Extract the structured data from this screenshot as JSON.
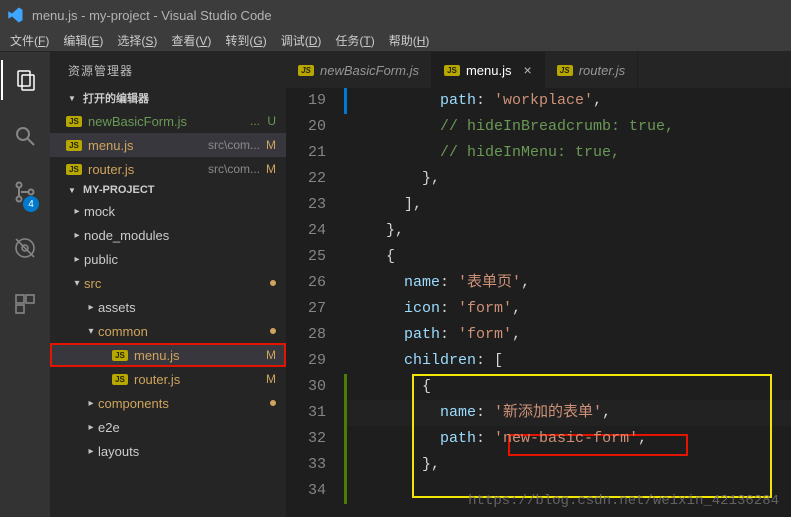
{
  "titlebar": {
    "text": "menu.js - my-project - Visual Studio Code"
  },
  "menubar": [
    {
      "label": "文件(F)",
      "hotkey": "F"
    },
    {
      "label": "编辑(E)",
      "hotkey": "E"
    },
    {
      "label": "选择(S)",
      "hotkey": "S"
    },
    {
      "label": "查看(V)",
      "hotkey": "V"
    },
    {
      "label": "转到(G)",
      "hotkey": "G"
    },
    {
      "label": "调试(D)",
      "hotkey": "D"
    },
    {
      "label": "任务(T)",
      "hotkey": "T"
    },
    {
      "label": "帮助(H)",
      "hotkey": "H"
    }
  ],
  "activitybar": {
    "scm_badge": "4"
  },
  "sidebar": {
    "title": "资源管理器",
    "open_editors": {
      "header": "打开的编辑器",
      "items": [
        {
          "file": "newBasicForm.js",
          "dir": "...",
          "status": "U",
          "kind": "untracked"
        },
        {
          "file": "menu.js",
          "dir": "src\\com...",
          "status": "M",
          "kind": "modified",
          "selected": true
        },
        {
          "file": "router.js",
          "dir": "src\\com...",
          "status": "M",
          "kind": "modified"
        }
      ]
    },
    "project": {
      "header": "MY-PROJECT",
      "tree": [
        {
          "type": "folder",
          "name": "mock",
          "depth": 1,
          "expanded": false
        },
        {
          "type": "folder",
          "name": "node_modules",
          "depth": 1,
          "expanded": false
        },
        {
          "type": "folder",
          "name": "public",
          "depth": 1,
          "expanded": false
        },
        {
          "type": "folder",
          "name": "src",
          "depth": 1,
          "expanded": true,
          "dirty": true
        },
        {
          "type": "folder",
          "name": "assets",
          "depth": 2,
          "expanded": false
        },
        {
          "type": "folder",
          "name": "common",
          "depth": 2,
          "expanded": true,
          "dirty": true
        },
        {
          "type": "file",
          "name": "menu.js",
          "depth": 3,
          "status": "M",
          "kind": "modified",
          "highlight": true
        },
        {
          "type": "file",
          "name": "router.js",
          "depth": 3,
          "status": "M",
          "kind": "modified"
        },
        {
          "type": "folder",
          "name": "components",
          "depth": 2,
          "expanded": false,
          "dirty": true
        },
        {
          "type": "folder",
          "name": "e2e",
          "depth": 2,
          "expanded": false
        },
        {
          "type": "folder",
          "name": "layouts",
          "depth": 2,
          "expanded": false
        }
      ]
    }
  },
  "tabs": [
    {
      "label": "newBasicForm.js",
      "active": false
    },
    {
      "label": "menu.js",
      "active": true
    },
    {
      "label": "router.js",
      "active": false
    }
  ],
  "editor": {
    "first_line_number": 19,
    "lines": [
      {
        "n": 19,
        "mod": "blue",
        "html": "          <span class='tok-key'>path</span><span class='tok-punc'>: </span><span class='tok-str'>'workplace'</span><span class='tok-punc'>,</span>"
      },
      {
        "n": 20,
        "html": "          <span class='tok-comment'>// hideInBreadcrumb: true,</span>"
      },
      {
        "n": 21,
        "html": "          <span class='tok-comment'>// hideInMenu: true,</span>"
      },
      {
        "n": 22,
        "html": "        <span class='tok-punc'>},</span>"
      },
      {
        "n": 23,
        "html": "      <span class='tok-punc'>],</span>"
      },
      {
        "n": 24,
        "html": "    <span class='tok-punc'>},</span>"
      },
      {
        "n": 25,
        "html": "    <span class='tok-punc'>{</span>"
      },
      {
        "n": 26,
        "html": "      <span class='tok-key'>name</span><span class='tok-punc'>: </span><span class='tok-str'>'表单页'</span><span class='tok-punc'>,</span>"
      },
      {
        "n": 27,
        "html": "      <span class='tok-key'>icon</span><span class='tok-punc'>: </span><span class='tok-str'>'form'</span><span class='tok-punc'>,</span>"
      },
      {
        "n": 28,
        "html": "      <span class='tok-key'>path</span><span class='tok-punc'>: </span><span class='tok-str'>'form'</span><span class='tok-punc'>,</span>"
      },
      {
        "n": 29,
        "html": "      <span class='tok-key'>children</span><span class='tok-punc'>: [</span>"
      },
      {
        "n": 30,
        "mod": "green",
        "html": "        <span class='tok-punc'>{</span>"
      },
      {
        "n": 31,
        "mod": "green",
        "html": "          <span class='tok-key'>name</span><span class='tok-punc'>: </span><span class='tok-str'>'新添加的表单'</span><span class='tok-punc'>,</span>",
        "caret": true
      },
      {
        "n": 32,
        "mod": "green",
        "html": "          <span class='tok-key'>path</span><span class='tok-punc'>: </span><span class='tok-str'>'new-basic-form'</span><span class='tok-punc'>,</span>"
      },
      {
        "n": 33,
        "mod": "green",
        "html": "        <span class='tok-punc'>},</span>"
      },
      {
        "n": 34,
        "mod": "green",
        "html": ""
      }
    ]
  },
  "watermark": "https://blog.csdn.net/weixin_42136284"
}
